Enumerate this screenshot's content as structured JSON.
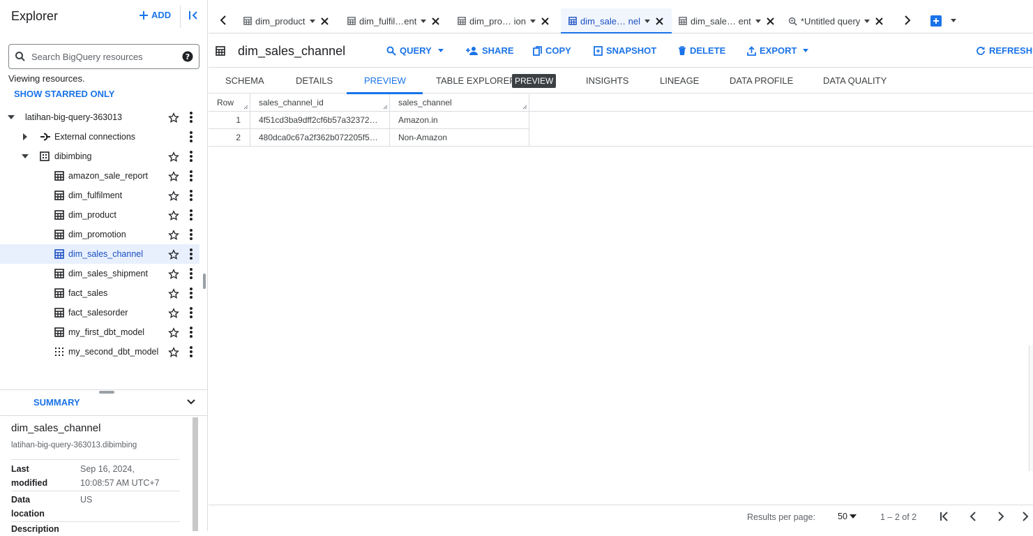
{
  "explorer": {
    "title": "Explorer",
    "add_label": "ADD",
    "search_placeholder": "Search BigQuery resources",
    "viewing_text": "Viewing resources.",
    "show_starred_label": "SHOW STARRED ONLY",
    "project": "latihan-big-query-363013",
    "external_connections": "External connections",
    "dataset": "dibimbing",
    "tables": [
      {
        "name": "amazon_sale_report",
        "icon": "table-icon"
      },
      {
        "name": "dim_fulfilment",
        "icon": "table-icon"
      },
      {
        "name": "dim_product",
        "icon": "table-icon"
      },
      {
        "name": "dim_promotion",
        "icon": "table-icon"
      },
      {
        "name": "dim_sales_channel",
        "icon": "table-icon",
        "selected": true
      },
      {
        "name": "dim_sales_shipment",
        "icon": "table-icon"
      },
      {
        "name": "fact_sales",
        "icon": "table-icon"
      },
      {
        "name": "fact_salesorder",
        "icon": "table-icon"
      },
      {
        "name": "my_first_dbt_model",
        "icon": "table-icon"
      },
      {
        "name": "my_second_dbt_model",
        "icon": "view-icon"
      }
    ]
  },
  "summary": {
    "tab_label": "SUMMARY",
    "title": "dim_sales_channel",
    "path": "latihan-big-query-363013.dibimbing",
    "last_modified_key_1": "Last",
    "last_modified_key_2": "modified",
    "last_modified_val_1": "Sep 16, 2024,",
    "last_modified_val_2": "10:08:57 AM UTC+7",
    "data_location_key_1": "Data",
    "data_location_key_2": "location",
    "data_location_val": "US",
    "description_key": "Description"
  },
  "tabs": [
    {
      "label": "dim_product",
      "icon": "table-icon"
    },
    {
      "label": "dim_fulfil…ent",
      "icon": "table-icon"
    },
    {
      "label": "dim_pro… ion",
      "icon": "table-icon"
    },
    {
      "label": "dim_sale… nel",
      "icon": "table-icon",
      "active": true
    },
    {
      "label": "dim_sale… ent",
      "icon": "table-icon"
    },
    {
      "label": "*Untitled query",
      "icon": "query-icon"
    }
  ],
  "toolbar": {
    "title": "dim_sales_channel",
    "query": "QUERY",
    "share": "SHARE",
    "copy": "COPY",
    "snapshot": "SNAPSHOT",
    "delete": "DELETE",
    "export": "EXPORT",
    "refresh": "REFRESH"
  },
  "subtabs": {
    "schema": "SCHEMA",
    "details": "DETAILS",
    "preview": "PREVIEW",
    "table_explorer": "TABLE EXPLORER",
    "table_explorer_badge": "PREVIEW",
    "insights": "INSIGHTS",
    "lineage": "LINEAGE",
    "data_profile": "DATA PROFILE",
    "data_quality": "DATA QUALITY"
  },
  "grid": {
    "columns": [
      "Row",
      "sales_channel_id",
      "sales_channel"
    ],
    "rows": [
      {
        "row": "1",
        "sales_channel_id": "4f51cd3ba9dff2cf6b57a32372…",
        "sales_channel": "Amazon.in"
      },
      {
        "row": "2",
        "sales_channel_id": "480dca0c67a2f362b072205f5…",
        "sales_channel": "Non-Amazon"
      }
    ]
  },
  "footer": {
    "rpp_label": "Results per page:",
    "rpp_value": "50",
    "range": "1 – 2 of 2"
  },
  "colors": {
    "accent": "#1a73e8",
    "selected_bg": "#e8f0fe"
  }
}
